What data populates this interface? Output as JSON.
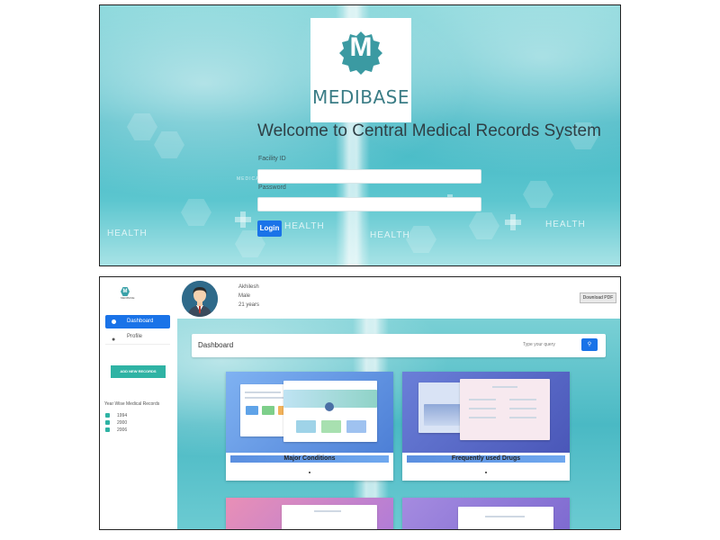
{
  "login": {
    "brand_letter": "M",
    "brand_name": "MEDIBASE",
    "welcome": "Welcome to Central Medical Records System",
    "facility_label": "Facility ID",
    "password_label": "Password",
    "login_button": "Login",
    "background_words": [
      "HEALTH",
      "HEALTH",
      "HEALTH",
      "HEALTH",
      "MEDICAL CARE"
    ]
  },
  "dashboard": {
    "sidebar": {
      "logo_letter": "M",
      "logo_name": "MEDIBASE",
      "nav_items": [
        {
          "label": "Dashboard",
          "icon": "dashboard-icon",
          "active": true
        },
        {
          "label": "Profile",
          "icon": "person-icon",
          "active": false
        }
      ],
      "add_record_button": "ADD NEW RECORDS",
      "records_title": "Year Wise Medical Records",
      "years": [
        "1994",
        "2000",
        "2006"
      ]
    },
    "patient": {
      "name": "Akhilesh",
      "gender": "Male",
      "age": "21 years"
    },
    "download_button": "Download PDF",
    "page_title": "Dashboard",
    "search_placeholder": "Type your query",
    "search_icon": "search-icon",
    "cards": [
      {
        "title": "Major Conditions"
      },
      {
        "title": "Frequently used Drugs"
      }
    ],
    "colors": {
      "primary": "#1a73e8",
      "accent": "#2fb3a4",
      "brand": "#3b7d86"
    }
  }
}
